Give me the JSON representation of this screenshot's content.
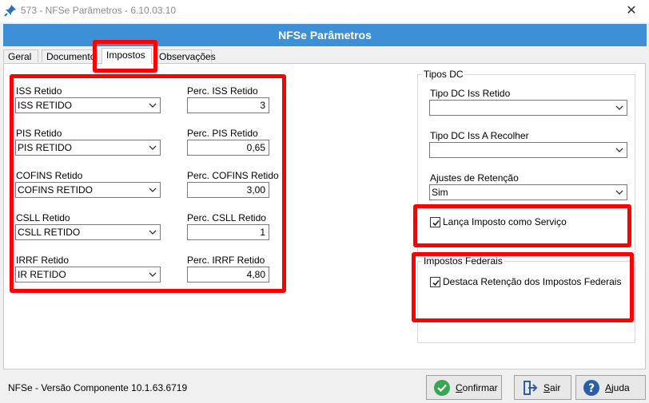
{
  "window": {
    "title": "573 - NFSe Parâmetros - 6.10.03.10",
    "close_glyph": "✕"
  },
  "banner": {
    "title": "NFSe Parâmetros"
  },
  "tabs": [
    "Geral",
    "Documento",
    "Impostos",
    "Observações"
  ],
  "active_tab": "Impostos",
  "impostos": {
    "iss": {
      "label": "ISS Retido",
      "value": "ISS RETIDO",
      "perc_label": "Perc. ISS Retido",
      "perc_value": "3"
    },
    "pis": {
      "label": "PIS Retido",
      "value": "PIS RETIDO",
      "perc_label": "Perc. PIS Retido",
      "perc_value": "0,65"
    },
    "cofins": {
      "label": "COFINS Retido",
      "value": "COFINS RETIDO",
      "perc_label": "Perc. COFINS Retido",
      "perc_value": "3,00"
    },
    "csll": {
      "label": "CSLL Retido",
      "value": "CSLL RETIDO",
      "perc_label": "Perc. CSLL Retido",
      "perc_value": "1"
    },
    "irrf": {
      "label": "IRRF Retido",
      "value": "IR RETIDO",
      "perc_label": "Perc. IRRF Retido",
      "perc_value": "4,80"
    }
  },
  "tipos_dc": {
    "legend": "Tipos DC",
    "iss_retido_label": "Tipo DC Iss Retido",
    "iss_retido_value": "",
    "iss_recolher_label": "Tipo DC Iss A Recolher",
    "iss_recolher_value": "",
    "ajustes_label": "Ajustes de Retenção",
    "ajustes_value": "Sim",
    "lanca_label": "Lança Imposto como Serviço",
    "lanca_checked": true
  },
  "impostos_federais": {
    "legend": "Impostos Federais",
    "destaca_label": "Destaca Retenção dos Impostos Federais",
    "destaca_checked": true
  },
  "footer": {
    "status": "NFSe - Versão Componente 10.1.63.6719",
    "confirm_first": "C",
    "confirm_rest": "onfirmar",
    "exit_first": "S",
    "exit_rest": "air",
    "help_first": "A",
    "help_rest": "juda"
  },
  "colors": {
    "banner": "#3d8fd6",
    "highlight": "#ff0000",
    "confirm_icon": "#3aa655",
    "exit_icon": "#2a5fa8",
    "help_icon": "#2a5fa8"
  }
}
